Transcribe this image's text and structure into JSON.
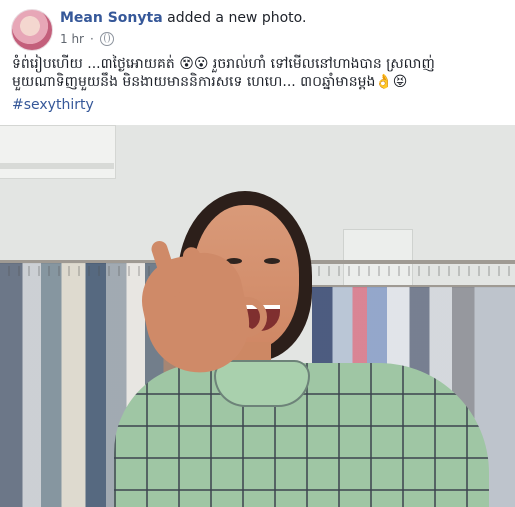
{
  "post": {
    "author": "Mean Sonyta",
    "action": "added a new photo.",
    "time": "1 hr",
    "text": "ទំព់រៀបហើយ ...៣ថ្ងៃអោយគត់ 😵😮 រួចរាល់ហាំ ទៅមើលនៅហាងបាន ស្រលាញ់ មួយណាទិញមួយនឹង មិនងាយមាននិការសទេ ហេហេ... ៣០ឆ្នាំមានម្តង👌😝",
    "hashtag": "#sexythirty"
  }
}
